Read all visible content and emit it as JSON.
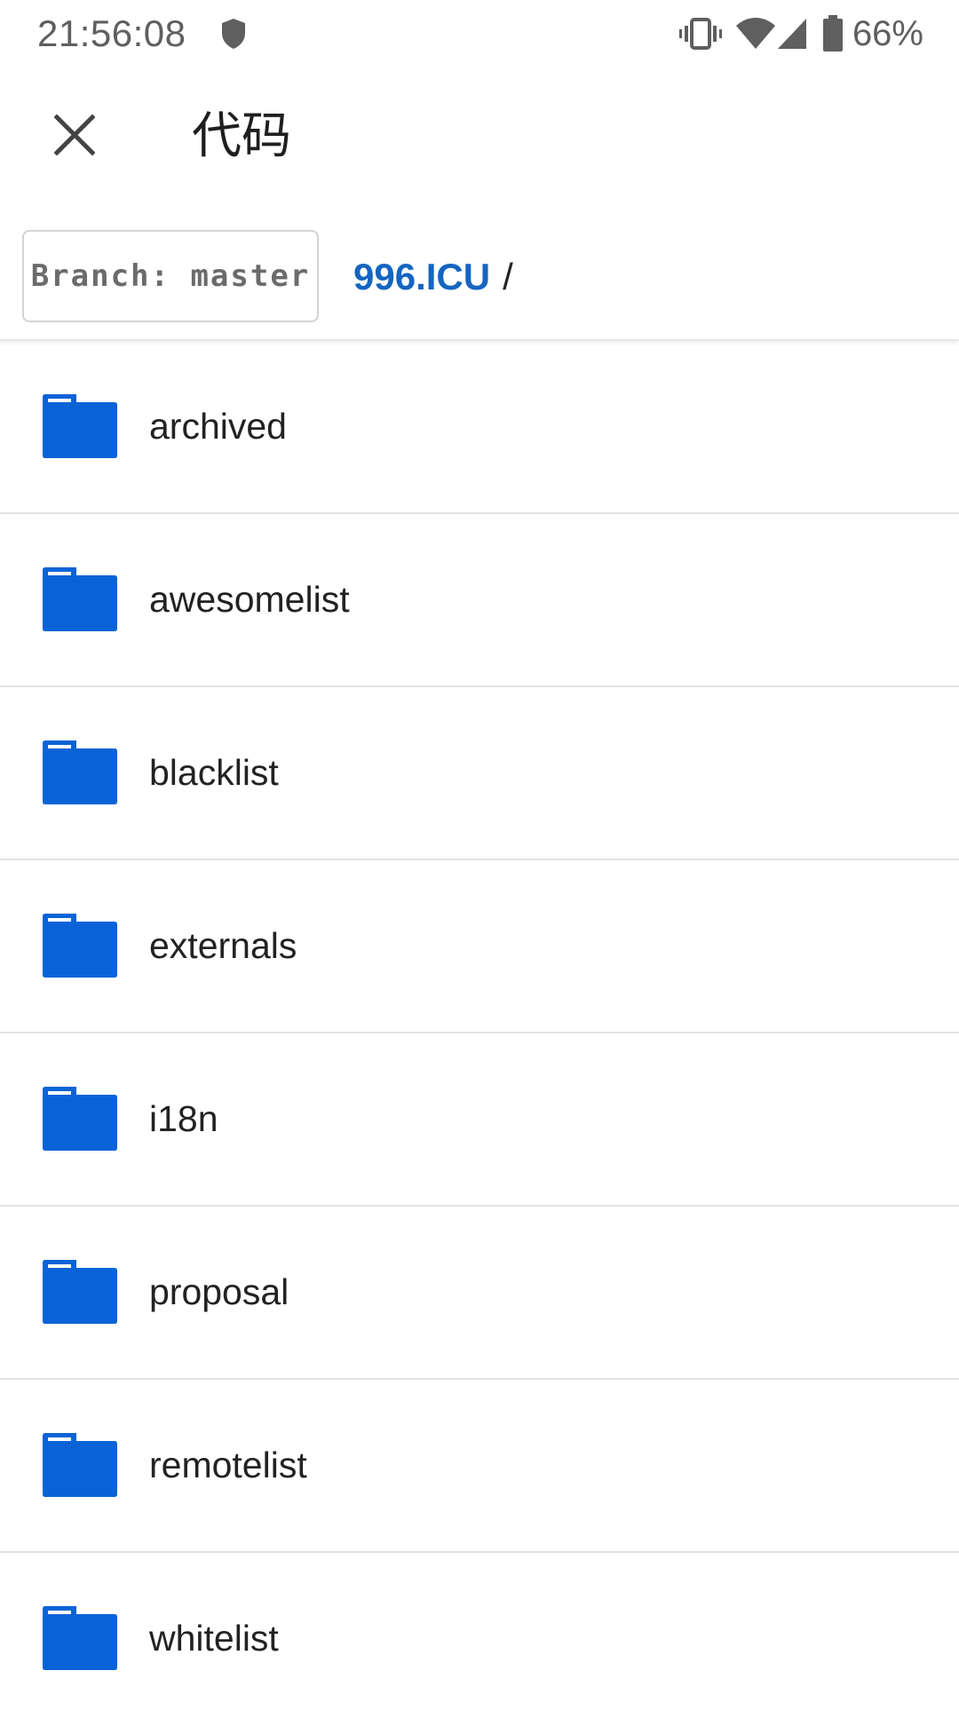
{
  "status_bar": {
    "time": "21:56:08",
    "battery_percent": "66%",
    "icons": [
      "shield-icon",
      "vibrate-icon",
      "wifi-icon",
      "signal-icon",
      "battery-icon"
    ]
  },
  "app_bar": {
    "title": "代码",
    "close_icon": "close-icon"
  },
  "branch": {
    "label": "Branch: master"
  },
  "breadcrumb": {
    "repo": "996.ICU",
    "separator": "/"
  },
  "colors": {
    "accent": "#1565c0",
    "folder": "#0a63d6"
  },
  "files": [
    {
      "name": "archived",
      "type": "folder",
      "icon": "folder-icon"
    },
    {
      "name": "awesomelist",
      "type": "folder",
      "icon": "folder-icon"
    },
    {
      "name": "blacklist",
      "type": "folder",
      "icon": "folder-icon"
    },
    {
      "name": "externals",
      "type": "folder",
      "icon": "folder-icon"
    },
    {
      "name": "i18n",
      "type": "folder",
      "icon": "folder-icon"
    },
    {
      "name": "proposal",
      "type": "folder",
      "icon": "folder-icon"
    },
    {
      "name": "remotelist",
      "type": "folder",
      "icon": "folder-icon"
    },
    {
      "name": "whitelist",
      "type": "folder",
      "icon": "folder-icon"
    }
  ]
}
